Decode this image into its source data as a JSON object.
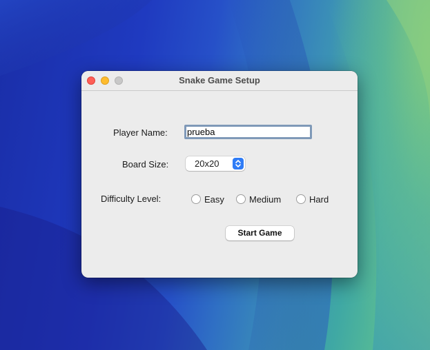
{
  "window": {
    "title": "Snake Game Setup"
  },
  "form": {
    "player_name_label": "Player Name:",
    "player_name_value": "prueba",
    "board_size_label": "Board Size:",
    "board_size_value": "20x20",
    "difficulty_label": "Difficulty Level:",
    "difficulty_options": [
      {
        "label": "Easy",
        "selected": false
      },
      {
        "label": "Medium",
        "selected": false
      },
      {
        "label": "Hard",
        "selected": false
      }
    ],
    "start_button_label": "Start Game"
  },
  "colors": {
    "close_button": "#fe5f57",
    "minimize_button": "#febc2e",
    "zoom_button": "#c8c8c8",
    "accent_blue": "#2f7cf6",
    "window_background": "#ececec"
  },
  "icons": {
    "stepper": "up-down-chevron-icon"
  }
}
